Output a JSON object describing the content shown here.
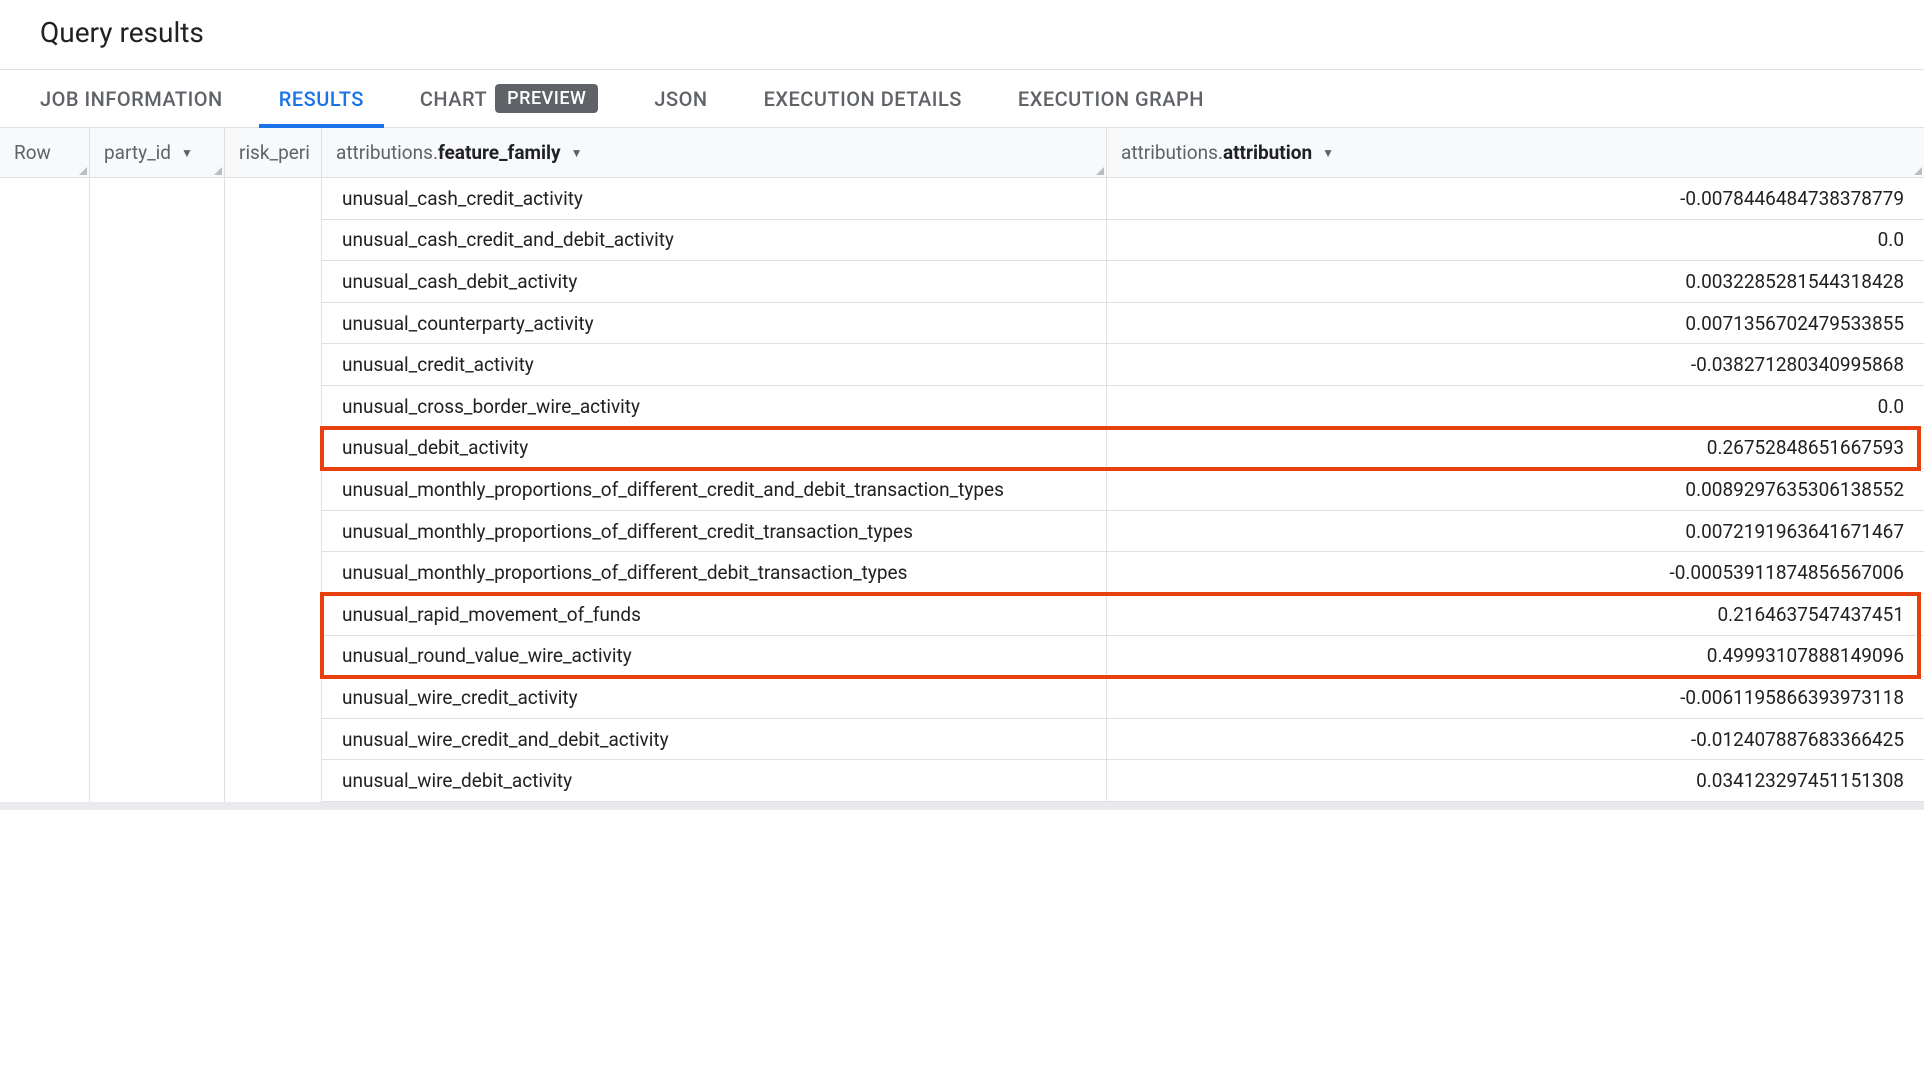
{
  "header": {
    "title": "Query results"
  },
  "tabs": {
    "items": [
      {
        "label": "JOB INFORMATION",
        "active": false
      },
      {
        "label": "RESULTS",
        "active": true
      },
      {
        "label": "CHART",
        "badge": "PREVIEW",
        "active": false
      },
      {
        "label": "JSON",
        "active": false
      },
      {
        "label": "EXECUTION DETAILS",
        "active": false
      },
      {
        "label": "EXECUTION GRAPH",
        "active": false
      }
    ]
  },
  "columns": {
    "row": "Row",
    "party_id": "party_id",
    "risk_peri": "risk_peri",
    "feature_family_prefix": "attributions.",
    "feature_family_bold": "feature_family",
    "attribution_prefix": "attributions.",
    "attribution_bold": "attribution"
  },
  "rows": [
    {
      "feature": "unusual_cash_credit_activity",
      "value": "-0.0078446484738378779",
      "highlighted": false
    },
    {
      "feature": "unusual_cash_credit_and_debit_activity",
      "value": "0.0",
      "highlighted": false
    },
    {
      "feature": "unusual_cash_debit_activity",
      "value": "0.0032285281544318428",
      "highlighted": false
    },
    {
      "feature": "unusual_counterparty_activity",
      "value": "0.0071356702479533855",
      "highlighted": false
    },
    {
      "feature": "unusual_credit_activity",
      "value": "-0.038271280340995868",
      "highlighted": false
    },
    {
      "feature": "unusual_cross_border_wire_activity",
      "value": "0.0",
      "highlighted": false
    },
    {
      "feature": "unusual_debit_activity",
      "value": "0.26752848651667593",
      "highlighted": true
    },
    {
      "feature": "unusual_monthly_proportions_of_different_credit_and_debit_transaction_types",
      "value": "0.0089297635306138552",
      "highlighted": false
    },
    {
      "feature": "unusual_monthly_proportions_of_different_credit_transaction_types",
      "value": "0.0072191963641671467",
      "highlighted": false
    },
    {
      "feature": "unusual_monthly_proportions_of_different_debit_transaction_types",
      "value": "-0.00053911874856567006",
      "highlighted": false
    },
    {
      "feature": "unusual_rapid_movement_of_funds",
      "value": "0.2164637547437451",
      "highlighted": true
    },
    {
      "feature": "unusual_round_value_wire_activity",
      "value": "0.49993107888149096",
      "highlighted": true
    },
    {
      "feature": "unusual_wire_credit_activity",
      "value": "-0.0061195866393973118",
      "highlighted": false
    },
    {
      "feature": "unusual_wire_credit_and_debit_activity",
      "value": "-0.012407887683366425",
      "highlighted": false
    },
    {
      "feature": "unusual_wire_debit_activity",
      "value": "0.034123297451151308",
      "highlighted": false
    }
  ]
}
